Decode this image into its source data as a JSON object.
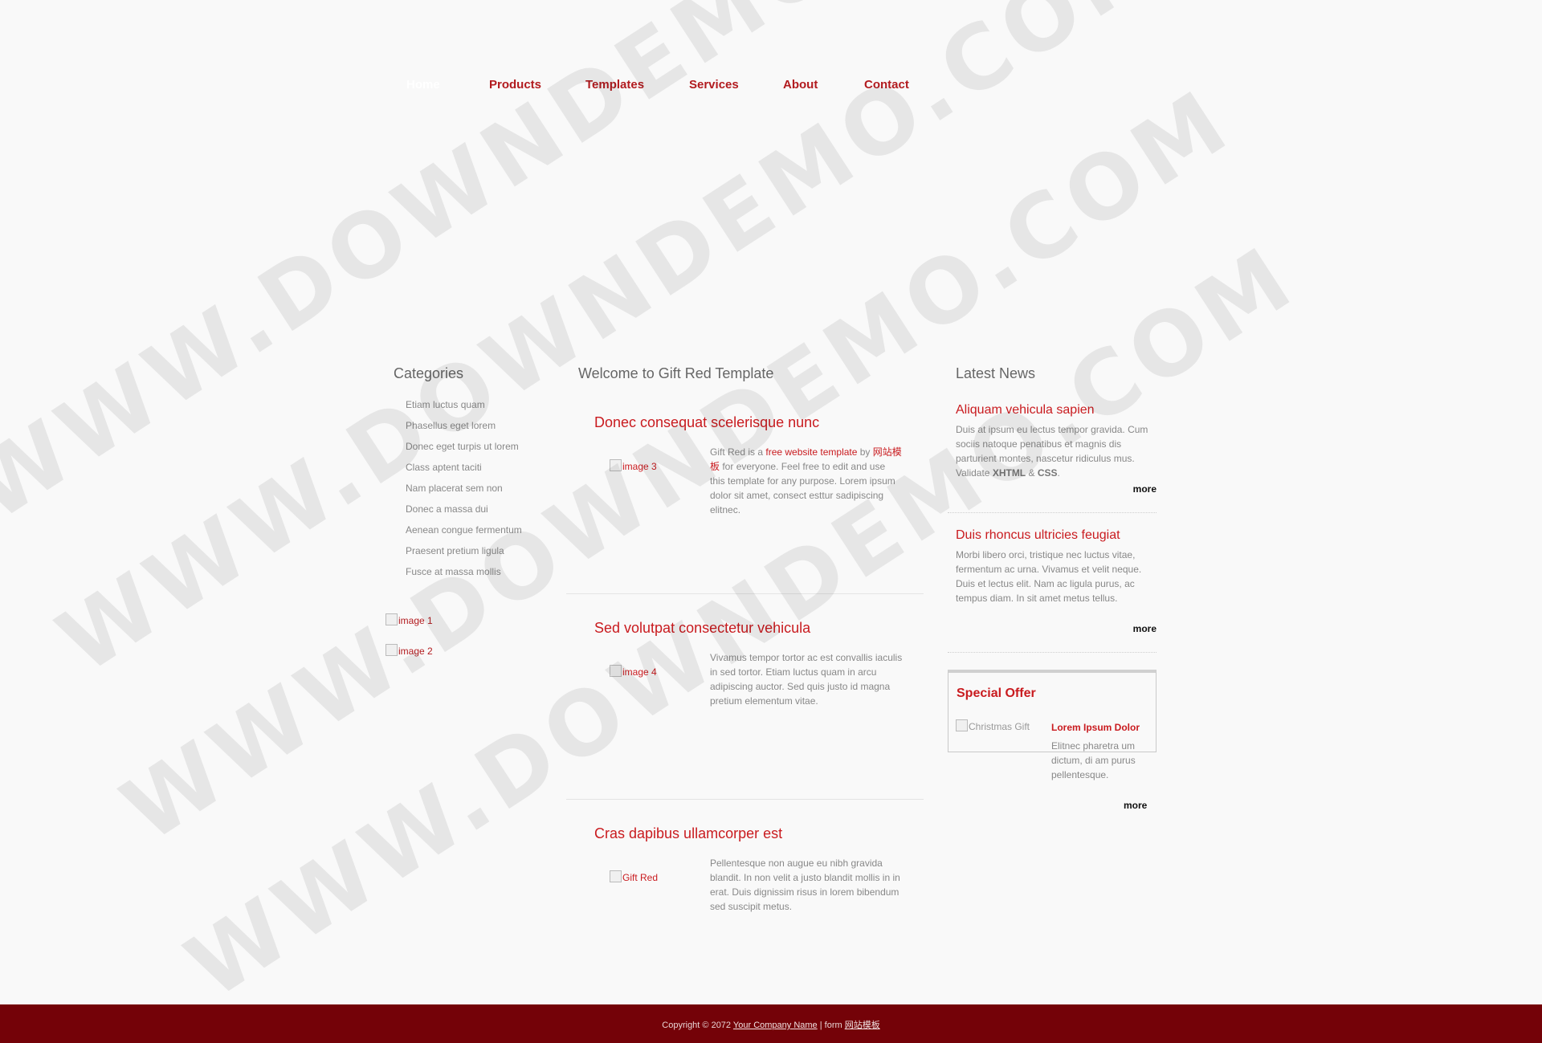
{
  "nav": {
    "items": [
      {
        "label": "Home",
        "current": true
      },
      {
        "label": "Products"
      },
      {
        "label": "Templates"
      },
      {
        "label": "Services"
      },
      {
        "label": "About"
      },
      {
        "label": "Contact"
      }
    ]
  },
  "sidebar": {
    "title": "Categories",
    "categories": [
      "Etiam luctus quam",
      "Phasellus eget lorem",
      "Donec eget turpis ut lorem",
      "Class aptent taciti",
      "Nam placerat sem non",
      "Donec a massa dui",
      "Aenean congue fermentum",
      "Praesent pretium ligula",
      "Fusce at massa mollis"
    ],
    "images": [
      "image 1",
      "image 2"
    ]
  },
  "main": {
    "title": "Welcome to Gift Red Template",
    "posts": [
      {
        "title": "Donec consequat scelerisque nunc",
        "image_alt": "image 3",
        "text_before_link": "Gift Red is a ",
        "link1": "free website template",
        "text_by": " by ",
        "link2": "网站模板",
        "text_after": " for everyone. Feel free to edit and use this template for any purpose. Lorem ipsum dolor sit amet, consect esttur sadipiscing elitnec."
      },
      {
        "title": "Sed volutpat consectetur vehicula",
        "image_alt": "image 4",
        "text": "Vivamus tempor tortor ac est convallis iaculis in sed tortor. Etiam luctus quam in arcu adipiscing auctor. Sed quis justo id magna pretium elementum vitae."
      },
      {
        "title": "Cras dapibus ullamcorper est",
        "image_alt": "Gift Red",
        "text": "Pellentesque non augue eu nibh gravida blandit. In non velit a justo blandit mollis in in erat. Duis dignissim risus in lorem bibendum sed suscipit metus."
      }
    ]
  },
  "news": {
    "title": "Latest News",
    "items": [
      {
        "title": "Aliquam vehicula sapien",
        "text": "Duis at ipsum eu lectus tempor gravida. Cum sociis natoque penatibus et magnis dis parturient montes, nascetur ridiculus mus. Validate ",
        "xhtml": "XHTML",
        "amp": " & ",
        "css": "CSS",
        "end": ".",
        "more": "more"
      },
      {
        "title": "Duis rhoncus ultricies feugiat",
        "text": "Morbi libero orci, tristique nec luctus vitae, fermentum ac urna. Vivamus et velit neque. Duis et lectus elit. Nam ac ligula purus, ac tempus diam. In sit amet metus tellus.",
        "more": "more"
      }
    ],
    "special": {
      "title": "Special Offer",
      "image_alt": "Christmas Gift",
      "subtitle": "Lorem Ipsum Dolor",
      "text": "Elitnec pharetra um dictum, di am purus pellentesque.",
      "more": "more"
    }
  },
  "footer": {
    "copyright": "Copyright © 2072 ",
    "company": "Your Company Name",
    "separator": " | form ",
    "link": "网站模板"
  },
  "watermark": "WWW.DOWNDEMO.COM",
  "colors": {
    "accent": "#c91b1f",
    "nav_text": "#b21b1f",
    "footer_bg": "#740208",
    "page_bg": "#f9f9f9"
  }
}
